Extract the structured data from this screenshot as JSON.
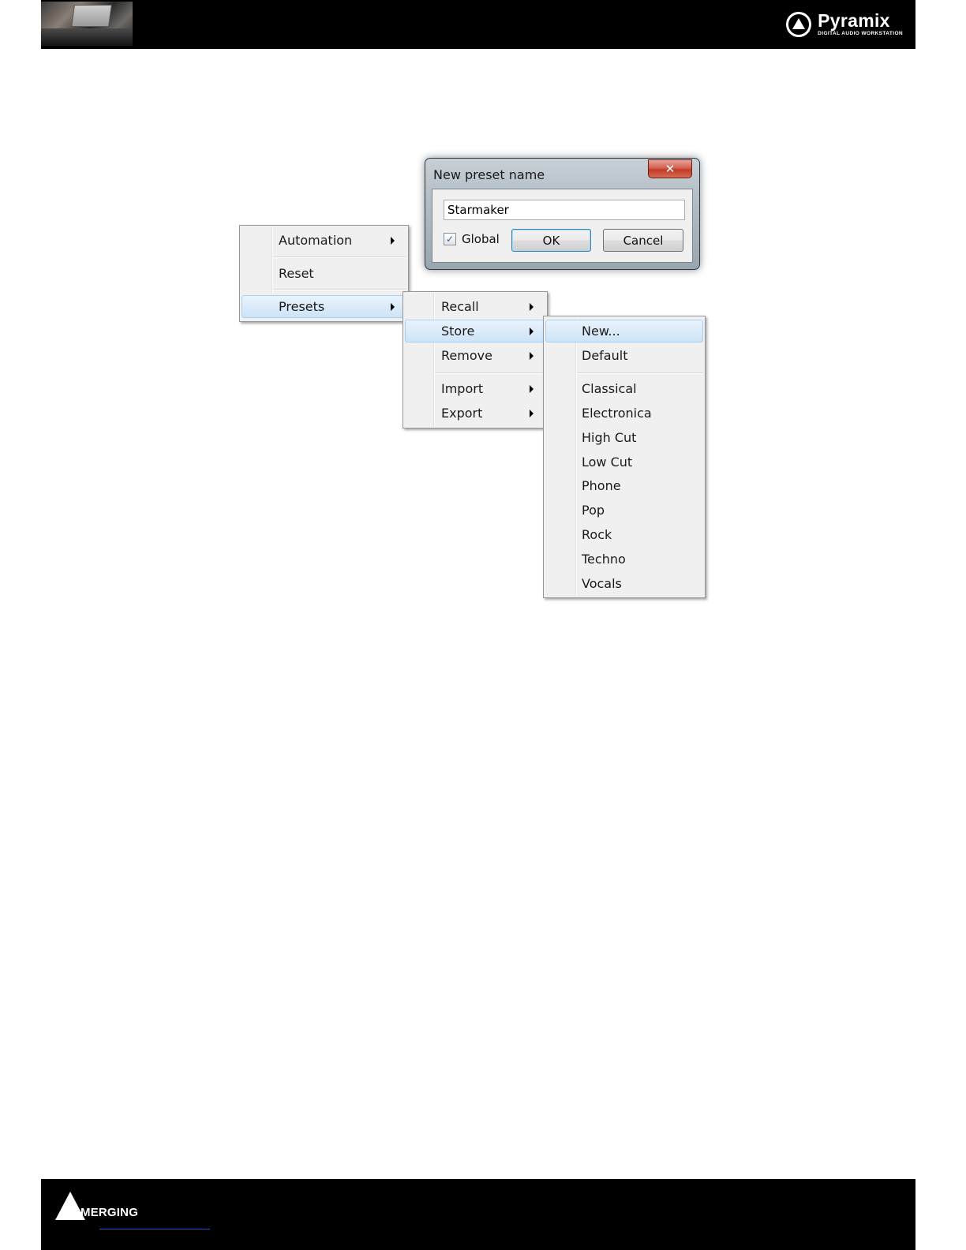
{
  "header": {
    "logo_name": "Pyramix",
    "logo_subtitle": "DIGITAL AUDIO WORKSTATION"
  },
  "footer": {
    "logo_name": "MERGING"
  },
  "menu_main": {
    "items": [
      {
        "label": "Automation",
        "submenu": true
      },
      {
        "label": "Reset",
        "submenu": false
      },
      {
        "label": "Presets",
        "submenu": true,
        "highlighted": true
      }
    ]
  },
  "menu_presets": {
    "items": [
      {
        "label": "Recall"
      },
      {
        "label": "Store",
        "highlighted": true
      },
      {
        "label": "Remove"
      },
      {
        "label": "Import"
      },
      {
        "label": "Export"
      }
    ]
  },
  "menu_store": {
    "items": [
      {
        "label": "New...",
        "highlighted": true
      },
      {
        "label": "Default"
      },
      {
        "label": "Classical"
      },
      {
        "label": "Electronica"
      },
      {
        "label": "High Cut"
      },
      {
        "label": "Low Cut"
      },
      {
        "label": "Phone"
      },
      {
        "label": "Pop"
      },
      {
        "label": "Rock"
      },
      {
        "label": "Techno"
      },
      {
        "label": "Vocals"
      }
    ]
  },
  "dialog": {
    "title": "New preset name",
    "close_label": "✕",
    "name_value": "Starmaker",
    "global_label": "Global",
    "global_checked": true,
    "ok_label": "OK",
    "cancel_label": "Cancel"
  },
  "colors": {
    "highlight": "#cde4f7",
    "menu_bg": "#f0f0f0",
    "band": "#000000"
  }
}
